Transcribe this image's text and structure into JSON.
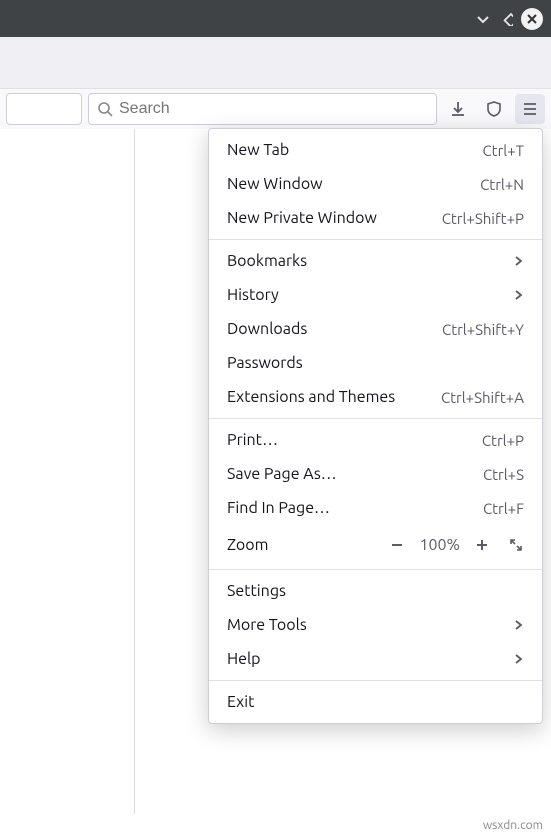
{
  "titlebar": {},
  "toolbar": {
    "search_placeholder": "Search"
  },
  "menu": {
    "new_tab": {
      "label": "New Tab",
      "shortcut": "Ctrl+T"
    },
    "new_window": {
      "label": "New Window",
      "shortcut": "Ctrl+N"
    },
    "new_private_window": {
      "label": "New Private Window",
      "shortcut": "Ctrl+Shift+P"
    },
    "bookmarks": {
      "label": "Bookmarks"
    },
    "history": {
      "label": "History"
    },
    "downloads": {
      "label": "Downloads",
      "shortcut": "Ctrl+Shift+Y"
    },
    "passwords": {
      "label": "Passwords"
    },
    "extensions": {
      "label": "Extensions and Themes",
      "shortcut": "Ctrl+Shift+A"
    },
    "print": {
      "label": "Print…",
      "shortcut": "Ctrl+P"
    },
    "save_as": {
      "label": "Save Page As…",
      "shortcut": "Ctrl+S"
    },
    "find": {
      "label": "Find In Page…",
      "shortcut": "Ctrl+F"
    },
    "zoom": {
      "label": "Zoom",
      "value": "100%"
    },
    "settings": {
      "label": "Settings"
    },
    "more_tools": {
      "label": "More Tools"
    },
    "help": {
      "label": "Help"
    },
    "exit": {
      "label": "Exit"
    }
  },
  "footer": {
    "watermark": "wsxdn.com"
  }
}
